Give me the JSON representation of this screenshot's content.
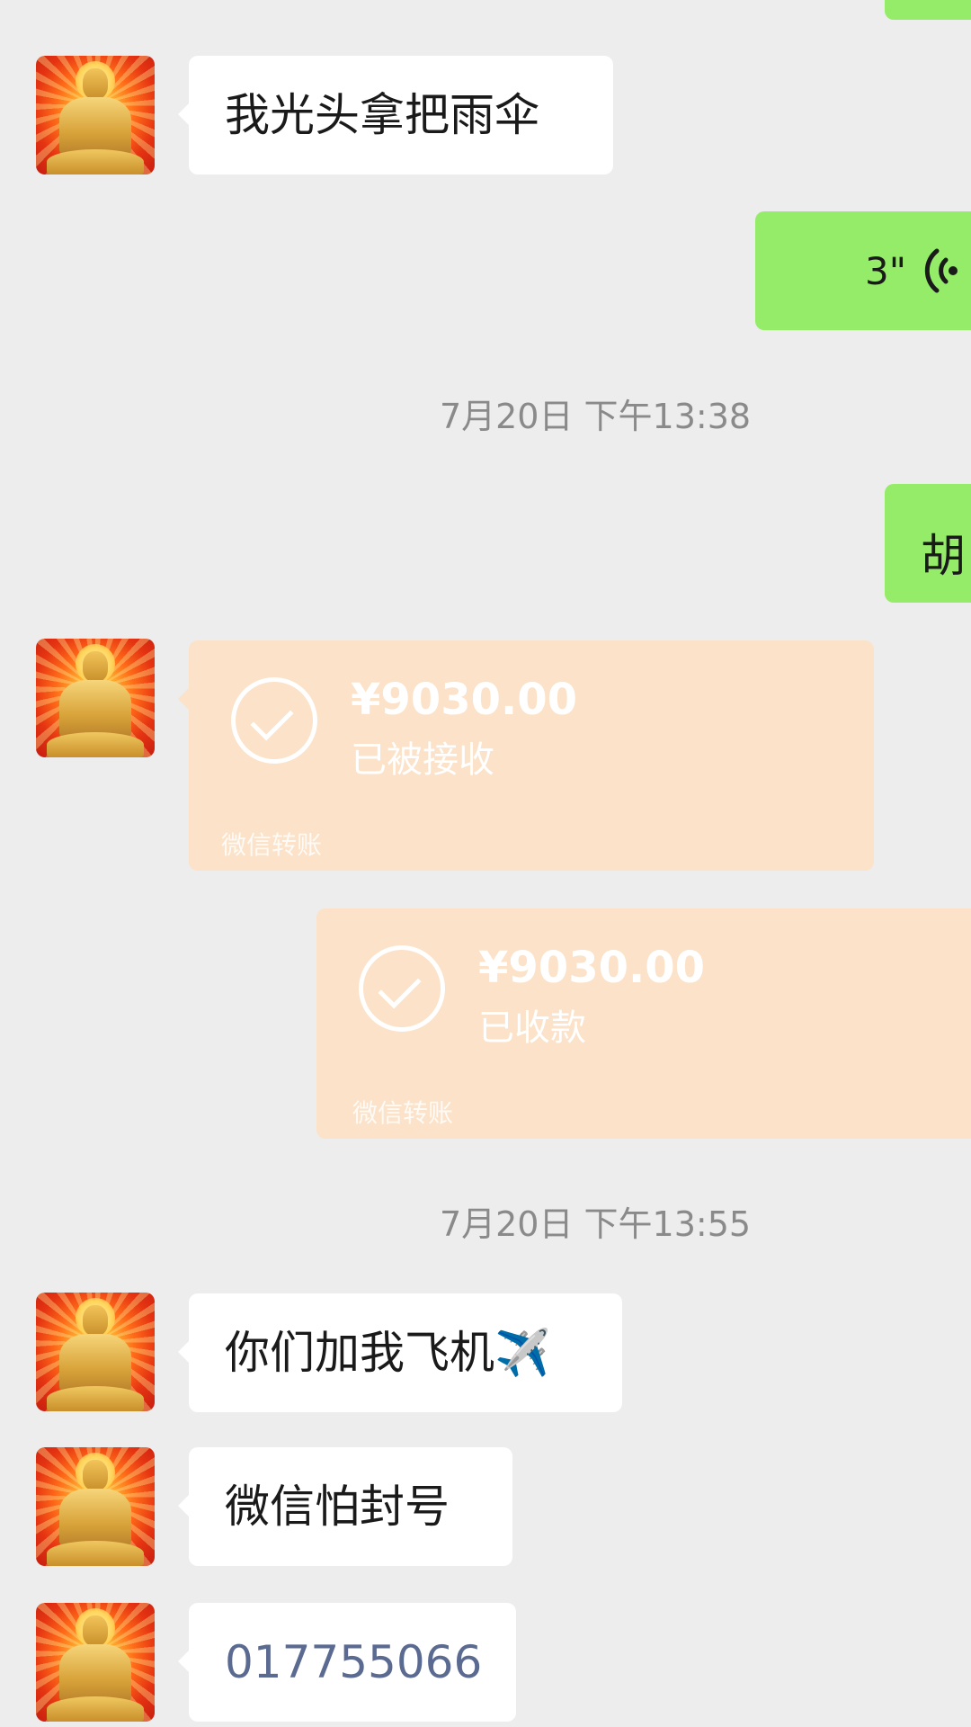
{
  "messages": {
    "m1": {
      "text": "我光头拿把雨伞"
    },
    "voice": {
      "duration": "3\"",
      "icon": "voice-wave-icon"
    },
    "time1": "7月20日 下午13:38",
    "m2": {
      "text": "胡"
    },
    "transfer1": {
      "amount": "¥9030.00",
      "status": "已被接收",
      "label": "微信转账"
    },
    "transfer2": {
      "amount": "¥9030.00",
      "status": "已收款",
      "label": "微信转账"
    },
    "time2": "7月20日 下午13:55",
    "m3": {
      "text": "你们加我飞机✈️"
    },
    "m4": {
      "text": "微信怕封号"
    },
    "m5": {
      "text": "017755066"
    }
  },
  "colors": {
    "background": "#ededed",
    "outgoing_bubble": "#95ec69",
    "incoming_bubble": "#ffffff",
    "transfer_card": "#fbe2c8",
    "number_link": "#5b6a91"
  }
}
